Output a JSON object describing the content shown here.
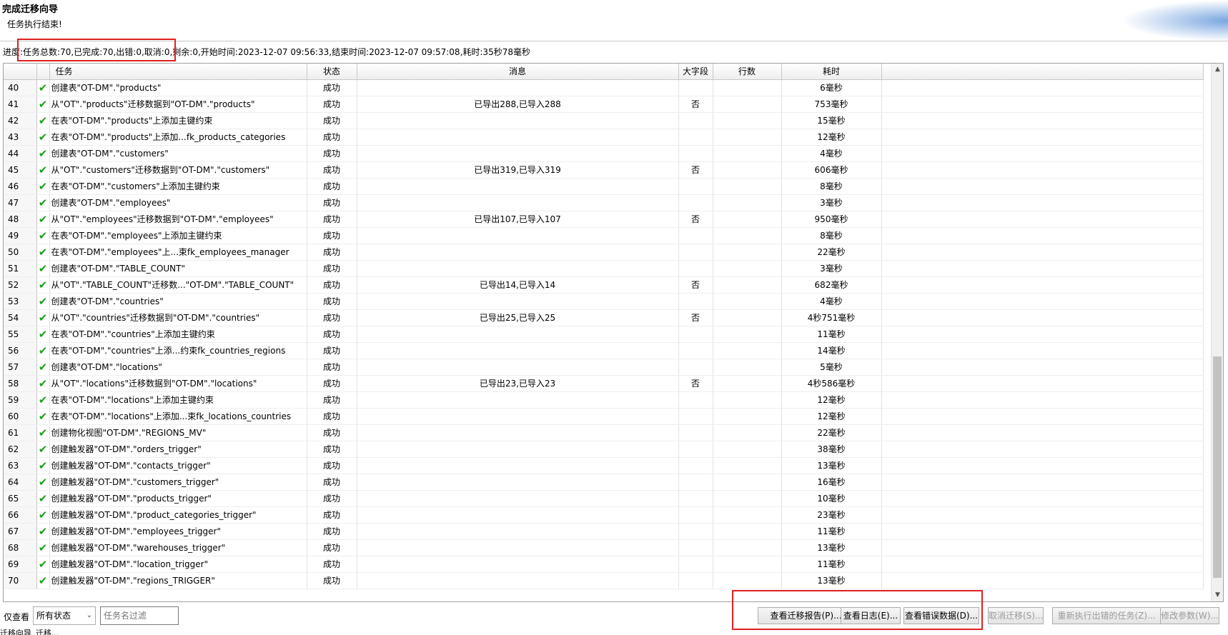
{
  "window": {
    "title": "完成迁移向导",
    "subtitle": "任务执行结束!"
  },
  "progress": {
    "text": "进度:任务总数:70,已完成:70,出错:0,取消:0,剩余:0,开始时间:2023-12-07 09:56:33,结束时间:2023-12-07 09:57:08,耗时:35秒78毫秒"
  },
  "table": {
    "headers": {
      "task": "任务",
      "status": "状态",
      "message": "消息",
      "bigfield": "大字段",
      "rows": "行数",
      "time": "耗时"
    },
    "rows": [
      {
        "num": "40",
        "task": "创建表\"OT-DM\".\"products\"",
        "status": "成功",
        "message": "",
        "bigfield": "",
        "rows": "",
        "time": "6毫秒"
      },
      {
        "num": "41",
        "task": "从\"OT\".\"products\"迁移数据到\"OT-DM\".\"products\"",
        "status": "成功",
        "message": "已导出288,已导入288",
        "bigfield": "否",
        "rows": "",
        "time": "753毫秒"
      },
      {
        "num": "42",
        "task": "在表\"OT-DM\".\"products\"上添加主键约束",
        "status": "成功",
        "message": "",
        "bigfield": "",
        "rows": "",
        "time": "15毫秒"
      },
      {
        "num": "43",
        "task": "在表\"OT-DM\".\"products\"上添加...fk_products_categories",
        "status": "成功",
        "message": "",
        "bigfield": "",
        "rows": "",
        "time": "12毫秒"
      },
      {
        "num": "44",
        "task": "创建表\"OT-DM\".\"customers\"",
        "status": "成功",
        "message": "",
        "bigfield": "",
        "rows": "",
        "time": "4毫秒"
      },
      {
        "num": "45",
        "task": "从\"OT\".\"customers\"迁移数据到\"OT-DM\".\"customers\"",
        "status": "成功",
        "message": "已导出319,已导入319",
        "bigfield": "否",
        "rows": "",
        "time": "606毫秒"
      },
      {
        "num": "46",
        "task": "在表\"OT-DM\".\"customers\"上添加主键约束",
        "status": "成功",
        "message": "",
        "bigfield": "",
        "rows": "",
        "time": "8毫秒"
      },
      {
        "num": "47",
        "task": "创建表\"OT-DM\".\"employees\"",
        "status": "成功",
        "message": "",
        "bigfield": "",
        "rows": "",
        "time": "3毫秒"
      },
      {
        "num": "48",
        "task": "从\"OT\".\"employees\"迁移数据到\"OT-DM\".\"employees\"",
        "status": "成功",
        "message": "已导出107,已导入107",
        "bigfield": "否",
        "rows": "",
        "time": "950毫秒"
      },
      {
        "num": "49",
        "task": "在表\"OT-DM\".\"employees\"上添加主键约束",
        "status": "成功",
        "message": "",
        "bigfield": "",
        "rows": "",
        "time": "8毫秒"
      },
      {
        "num": "50",
        "task": "在表\"OT-DM\".\"employees\"上...束fk_employees_manager",
        "status": "成功",
        "message": "",
        "bigfield": "",
        "rows": "",
        "time": "22毫秒"
      },
      {
        "num": "51",
        "task": "创建表\"OT-DM\".\"TABLE_COUNT\"",
        "status": "成功",
        "message": "",
        "bigfield": "",
        "rows": "",
        "time": "3毫秒"
      },
      {
        "num": "52",
        "task": "从\"OT\".\"TABLE_COUNT\"迁移数...\"OT-DM\".\"TABLE_COUNT\"",
        "status": "成功",
        "message": "已导出14,已导入14",
        "bigfield": "否",
        "rows": "",
        "time": "682毫秒"
      },
      {
        "num": "53",
        "task": "创建表\"OT-DM\".\"countries\"",
        "status": "成功",
        "message": "",
        "bigfield": "",
        "rows": "",
        "time": "4毫秒"
      },
      {
        "num": "54",
        "task": "从\"OT\".\"countries\"迁移数据到\"OT-DM\".\"countries\"",
        "status": "成功",
        "message": "已导出25,已导入25",
        "bigfield": "否",
        "rows": "",
        "time": "4秒751毫秒"
      },
      {
        "num": "55",
        "task": "在表\"OT-DM\".\"countries\"上添加主键约束",
        "status": "成功",
        "message": "",
        "bigfield": "",
        "rows": "",
        "time": "11毫秒"
      },
      {
        "num": "56",
        "task": "在表\"OT-DM\".\"countries\"上添...约束fk_countries_regions",
        "status": "成功",
        "message": "",
        "bigfield": "",
        "rows": "",
        "time": "14毫秒"
      },
      {
        "num": "57",
        "task": "创建表\"OT-DM\".\"locations\"",
        "status": "成功",
        "message": "",
        "bigfield": "",
        "rows": "",
        "time": "5毫秒"
      },
      {
        "num": "58",
        "task": "从\"OT\".\"locations\"迁移数据到\"OT-DM\".\"locations\"",
        "status": "成功",
        "message": "已导出23,已导入23",
        "bigfield": "否",
        "rows": "",
        "time": "4秒586毫秒"
      },
      {
        "num": "59",
        "task": "在表\"OT-DM\".\"locations\"上添加主键约束",
        "status": "成功",
        "message": "",
        "bigfield": "",
        "rows": "",
        "time": "12毫秒"
      },
      {
        "num": "60",
        "task": "在表\"OT-DM\".\"locations\"上添加...束fk_locations_countries",
        "status": "成功",
        "message": "",
        "bigfield": "",
        "rows": "",
        "time": "12毫秒"
      },
      {
        "num": "61",
        "task": "创建物化视图\"OT-DM\".\"REGIONS_MV\"",
        "status": "成功",
        "message": "",
        "bigfield": "",
        "rows": "",
        "time": "22毫秒"
      },
      {
        "num": "62",
        "task": "创建触发器\"OT-DM\".\"orders_trigger\"",
        "status": "成功",
        "message": "",
        "bigfield": "",
        "rows": "",
        "time": "38毫秒"
      },
      {
        "num": "63",
        "task": "创建触发器\"OT-DM\".\"contacts_trigger\"",
        "status": "成功",
        "message": "",
        "bigfield": "",
        "rows": "",
        "time": "13毫秒"
      },
      {
        "num": "64",
        "task": "创建触发器\"OT-DM\".\"customers_trigger\"",
        "status": "成功",
        "message": "",
        "bigfield": "",
        "rows": "",
        "time": "16毫秒"
      },
      {
        "num": "65",
        "task": "创建触发器\"OT-DM\".\"products_trigger\"",
        "status": "成功",
        "message": "",
        "bigfield": "",
        "rows": "",
        "time": "10毫秒"
      },
      {
        "num": "66",
        "task": "创建触发器\"OT-DM\".\"product_categories_trigger\"",
        "status": "成功",
        "message": "",
        "bigfield": "",
        "rows": "",
        "time": "23毫秒"
      },
      {
        "num": "67",
        "task": "创建触发器\"OT-DM\".\"employees_trigger\"",
        "status": "成功",
        "message": "",
        "bigfield": "",
        "rows": "",
        "time": "11毫秒"
      },
      {
        "num": "68",
        "task": "创建触发器\"OT-DM\".\"warehouses_trigger\"",
        "status": "成功",
        "message": "",
        "bigfield": "",
        "rows": "",
        "time": "13毫秒"
      },
      {
        "num": "69",
        "task": "创建触发器\"OT-DM\".\"location_trigger\"",
        "status": "成功",
        "message": "",
        "bigfield": "",
        "rows": "",
        "time": "11毫秒"
      },
      {
        "num": "70",
        "task": "创建触发器\"OT-DM\".\"regions_TRIGGER\"",
        "status": "成功",
        "message": "",
        "bigfield": "",
        "rows": "",
        "time": "13毫秒"
      }
    ]
  },
  "filter": {
    "label": "仅查看",
    "status_value": "所有状态",
    "name_placeholder": "任务名过滤"
  },
  "buttons": {
    "report": "查看迁移报告(P)...",
    "log": "查看日志(E)...",
    "error_data": "查看错误数据(D)...",
    "cancel": "取消迁移(S)...",
    "rerun": "重新执行出错的任务(Z)...",
    "modify": "修改参数(W)..."
  },
  "tabs": [
    "迁移向导",
    "迁移..."
  ],
  "icons": {
    "row_status": "check-icon"
  },
  "colors": {
    "success": "#1aa01a",
    "annotation": "#e02020"
  }
}
